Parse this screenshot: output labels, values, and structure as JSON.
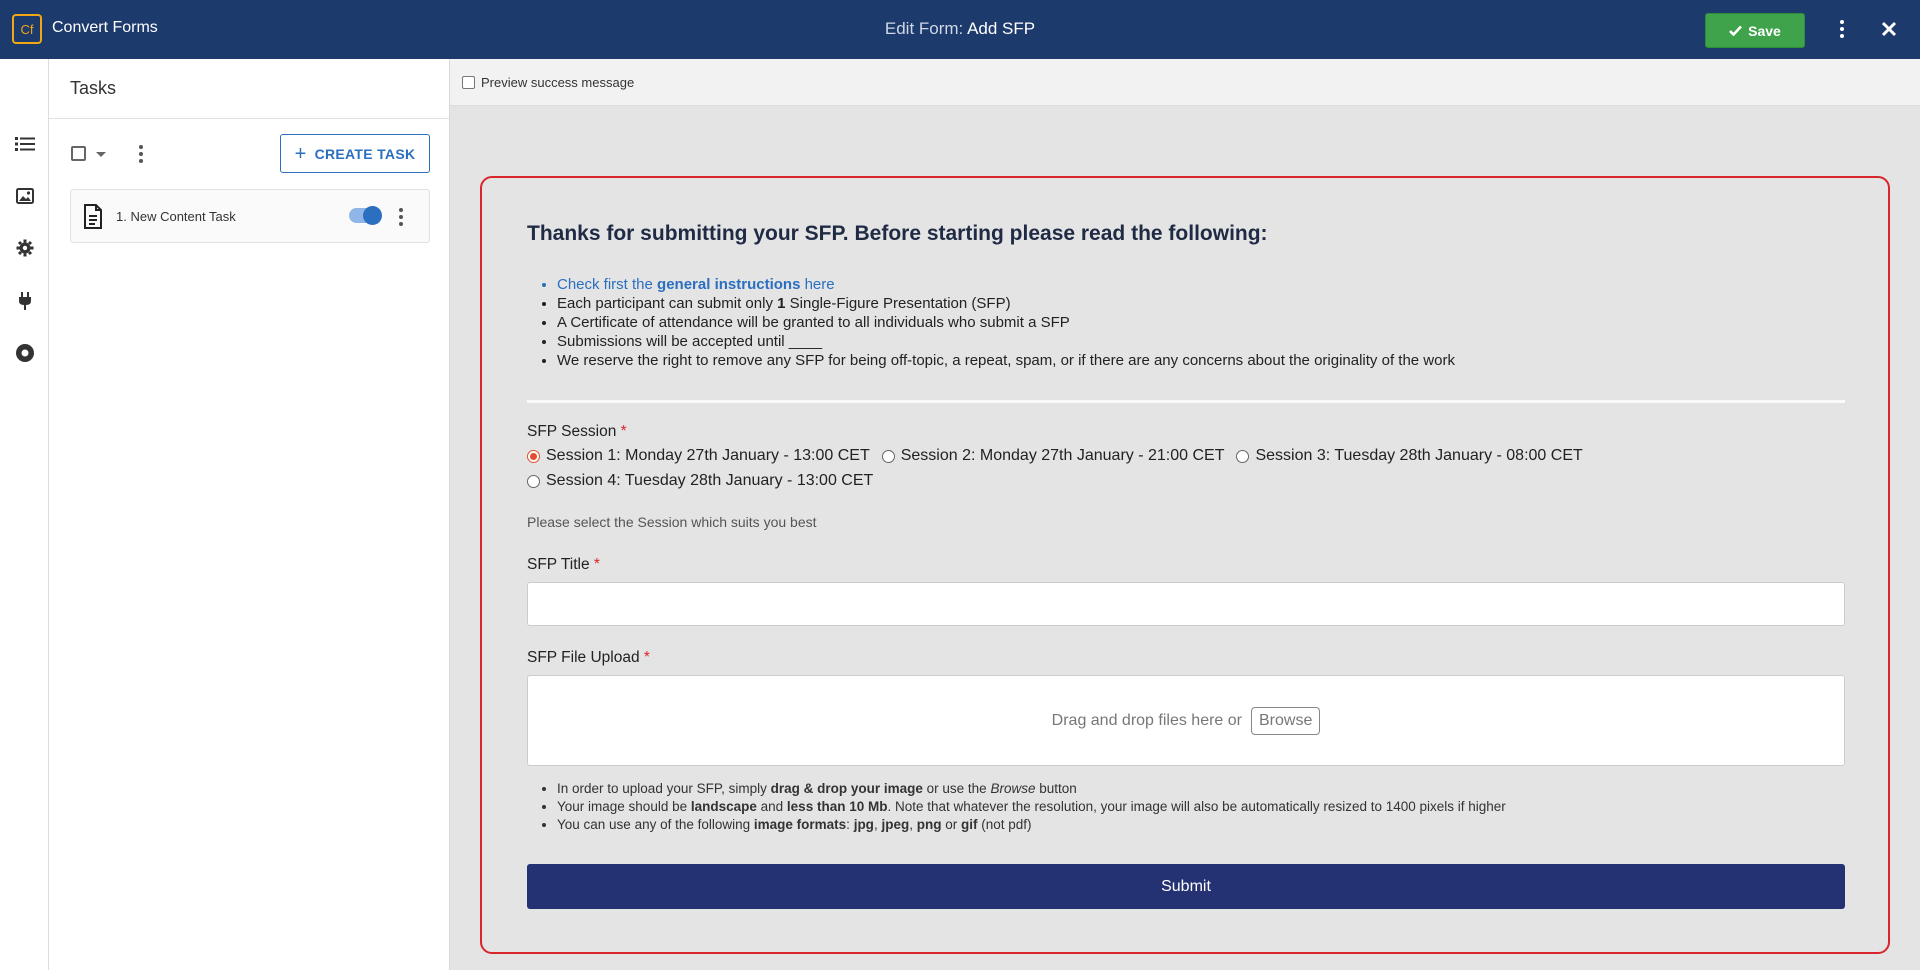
{
  "header": {
    "logo_text": "Cf",
    "app_name": "Convert Forms",
    "title_prefix": "Edit Form:",
    "title": "Add SFP",
    "save_label": "Save"
  },
  "rail": {
    "icons": [
      "list-icon",
      "image-icon",
      "gear-icon",
      "plug-icon",
      "target-icon"
    ]
  },
  "tasks": {
    "title": "Tasks",
    "create_label": "CREATE TASK",
    "items": [
      {
        "label": "1. New Content Task",
        "enabled": true
      }
    ]
  },
  "preview": {
    "checkbox_label": "Preview success message",
    "checked": false
  },
  "form": {
    "heading": "Thanks for submitting your SFP. Before starting please read the following:",
    "bullets": {
      "b1_pre": "Check first the ",
      "b1_bold": "general instructions",
      "b1_post": " here",
      "b2_pre": "Each participant can submit only ",
      "b2_bold": "1",
      "b2_post": " Single-Figure Presentation (SFP)",
      "b3": "A Certificate of attendance will be granted to all individuals who submit a SFP",
      "b4": "Submissions will be accepted until ____",
      "b5": "We reserve the right to remove any SFP for being off-topic, a repeat, spam, or if there are any concerns about the originality of the work"
    },
    "session": {
      "label": "SFP Session",
      "required_mark": "*",
      "options": [
        "Session 1: Monday 27th January - 13:00 CET",
        "Session 2: Monday 27th January - 21:00 CET",
        "Session 3: Tuesday 28th January - 08:00 CET",
        "Session 4: Tuesday 28th January - 13:00 CET"
      ],
      "selected": "Session 1: Monday 27th January - 13:00 CET",
      "help": "Please select the Session which suits you best"
    },
    "title_field": {
      "label": "SFP Title",
      "required_mark": "*",
      "value": ""
    },
    "upload": {
      "label": "SFP File Upload",
      "required_mark": "*",
      "drop_text": "Drag and drop files here or",
      "browse_label": "Browse"
    },
    "notes": {
      "n1_a": "In order to upload your SFP, simply ",
      "n1_b": "drag & drop your image",
      "n1_c": " or use the ",
      "n1_d": "Browse",
      "n1_e": " button",
      "n2_a": "Your image should be ",
      "n2_b": "landscape",
      "n2_c": " and ",
      "n2_d": "less than 10 Mb",
      "n2_e": ". Note that whatever the resolution, your image will also be automatically resized to 1400 pixels if higher",
      "n3_a": "You can use any of the following ",
      "n3_b": "image formats",
      "n3_c": ": ",
      "n3_d": "jpg",
      "n3_e": ", ",
      "n3_f": "jpeg",
      "n3_g": ", ",
      "n3_h": "png",
      "n3_i": " or ",
      "n3_j": "gif",
      "n3_k": " (not pdf)"
    },
    "submit_label": "Submit"
  },
  "colors": {
    "topbar": "#1c3a6b",
    "save": "#3ea34a",
    "accent": "#2a6fc0",
    "form_border": "#d9262b",
    "submit": "#243172"
  }
}
